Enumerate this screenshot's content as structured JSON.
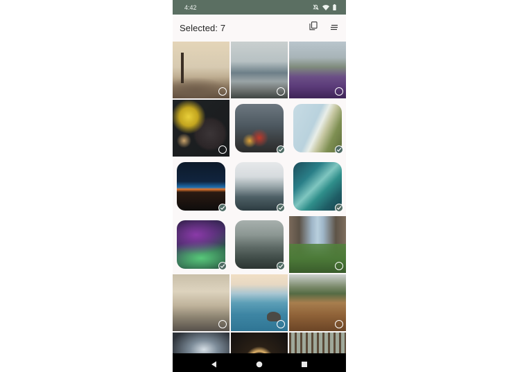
{
  "status_bar": {
    "time": "4:42"
  },
  "app_bar": {
    "title": "Selected: 7"
  },
  "colors": {
    "status_bar": "#5b6f62",
    "check_fill": "#4f6b64",
    "background": "#fbf8f8"
  },
  "icons": {
    "status": [
      "mute-icon",
      "wifi-icon",
      "battery-icon"
    ],
    "app_bar": [
      "copy-icon",
      "menu-icon"
    ],
    "nav": [
      "back-icon",
      "home-icon",
      "recents-icon"
    ]
  },
  "photos": [
    {
      "subject": "pebbles and post by sea",
      "selected": false
    },
    {
      "subject": "coastal cliffs",
      "selected": false
    },
    {
      "subject": "purple lavender field",
      "selected": false
    },
    {
      "subject": "food with yellow flowers",
      "selected": false
    },
    {
      "subject": "rainy window city lights",
      "selected": true
    },
    {
      "subject": "lighthouse cliffs",
      "selected": true
    },
    {
      "subject": "earth horizon at night",
      "selected": true
    },
    {
      "subject": "misty mountain",
      "selected": true
    },
    {
      "subject": "ocean wave",
      "selected": true
    },
    {
      "subject": "aurora from space",
      "selected": true
    },
    {
      "subject": "foggy forest",
      "selected": true
    },
    {
      "subject": "city street with trees",
      "selected": false
    },
    {
      "subject": "old apartment buildings",
      "selected": false
    },
    {
      "subject": "rock in calm sea",
      "selected": false
    },
    {
      "subject": "dry golden grass",
      "selected": false
    },
    {
      "subject": "lens glare",
      "selected": false
    },
    {
      "subject": "light tunnel",
      "selected": false
    },
    {
      "subject": "pine forest",
      "selected": false
    }
  ]
}
